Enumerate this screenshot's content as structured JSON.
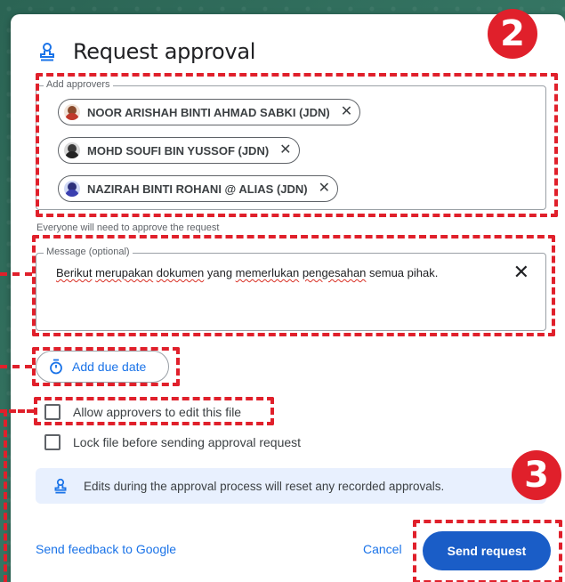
{
  "dialog": {
    "title": "Request approval",
    "approvers": {
      "legend": "Add approvers",
      "chips": [
        {
          "name": "NOOR ARISHAH BINTI AHMAD SABKI (JDN)",
          "remove": "✕"
        },
        {
          "name": "MOHD SOUFI BIN YUSSOF (JDN)",
          "remove": "✕"
        },
        {
          "name": "NAZIRAH BINTI ROHANI @ ALIAS (JDN)",
          "remove": "✕"
        }
      ],
      "helper": "Everyone will need to approve the request"
    },
    "message": {
      "legend": "Message (optional)",
      "value_parts": [
        {
          "text": "Berikut",
          "misspelled": true
        },
        {
          "text": " "
        },
        {
          "text": "merupakan",
          "misspelled": true
        },
        {
          "text": " "
        },
        {
          "text": "dokumen",
          "misspelled": true
        },
        {
          "text": " yang "
        },
        {
          "text": "memerlukan",
          "misspelled": true
        },
        {
          "text": " "
        },
        {
          "text": "pengesahan",
          "misspelled": true
        },
        {
          "text": " semua pihak."
        }
      ],
      "clear_icon": "✕"
    },
    "due_date_label": "Add due date",
    "allow_edit_label": "Allow approvers to edit this file",
    "lock_file_label": "Lock file before sending approval request",
    "info_text": "Edits during the approval process will reset any recorded approvals.",
    "feedback_link": "Send feedback to Google",
    "cancel_label": "Cancel",
    "send_label": "Send request"
  },
  "annotations": {
    "badge_two": "2",
    "badge_three": "3",
    "color": "#e0202b"
  },
  "colors": {
    "accent": "#1a73e8",
    "primary_button": "#1a5dc7",
    "info_bg": "#e8f0fe"
  }
}
